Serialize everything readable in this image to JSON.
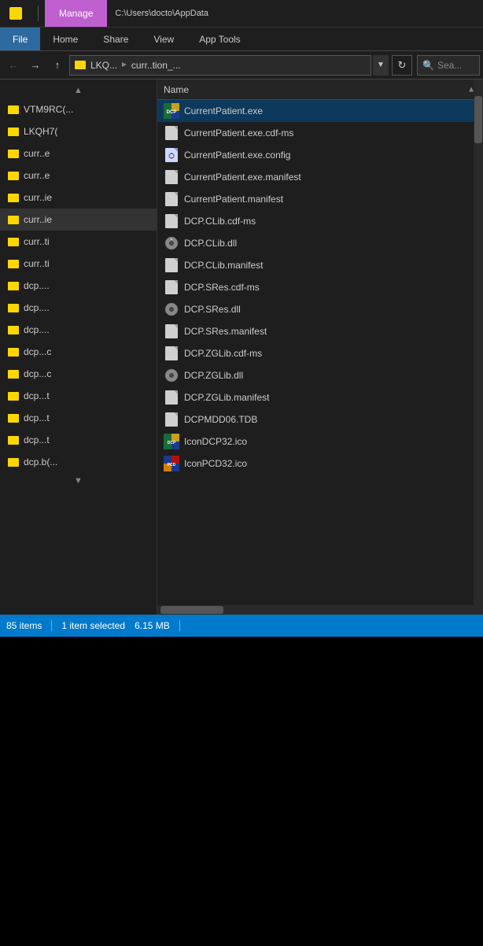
{
  "titlebar": {
    "manage_label": "Manage",
    "path": "C:\\Users\\docto\\AppData"
  },
  "ribbon": {
    "tabs": [
      "File",
      "Home",
      "Share",
      "View",
      "App Tools"
    ]
  },
  "addressbar": {
    "breadcrumb_folder": "LKQH7(...)",
    "breadcrumb_part1": "LKQ...",
    "breadcrumb_part2": "curr..tion_...",
    "search_placeholder": "Sea..."
  },
  "sidebar": {
    "items": [
      {
        "label": "VTM9RC(..."
      },
      {
        "label": "LKQH7("
      },
      {
        "label": "curr..e"
      },
      {
        "label": "curr..e"
      },
      {
        "label": "curr..ie"
      },
      {
        "label": "curr..ie"
      },
      {
        "label": "curr..ti"
      },
      {
        "label": "curr..ti"
      },
      {
        "label": "dcp...."
      },
      {
        "label": "dcp...."
      },
      {
        "label": "dcp...."
      },
      {
        "label": "dcp...c"
      },
      {
        "label": "dcp...c"
      },
      {
        "label": "dcp...t"
      },
      {
        "label": "dcp...t"
      },
      {
        "label": "dcp...t"
      },
      {
        "label": "dcp.b(..."
      }
    ]
  },
  "filelist": {
    "column_name": "Name",
    "items": [
      {
        "name": "CurrentPatient.exe",
        "icon_type": "dcp",
        "selected": true
      },
      {
        "name": "CurrentPatient.exe.cdf-ms",
        "icon_type": "generic",
        "selected": false
      },
      {
        "name": "CurrentPatient.exe.config",
        "icon_type": "config",
        "selected": false
      },
      {
        "name": "CurrentPatient.exe.manifest",
        "icon_type": "generic",
        "selected": false
      },
      {
        "name": "CurrentPatient.manifest",
        "icon_type": "generic",
        "selected": false
      },
      {
        "name": "DCP.CLib.cdf-ms",
        "icon_type": "generic",
        "selected": false
      },
      {
        "name": "DCP.CLib.dll",
        "icon_type": "dll",
        "selected": false
      },
      {
        "name": "DCP.CLib.manifest",
        "icon_type": "generic",
        "selected": false
      },
      {
        "name": "DCP.SRes.cdf-ms",
        "icon_type": "generic",
        "selected": false
      },
      {
        "name": "DCP.SRes.dll",
        "icon_type": "dll",
        "selected": false
      },
      {
        "name": "DCP.SRes.manifest",
        "icon_type": "generic",
        "selected": false
      },
      {
        "name": "DCP.ZGLib.cdf-ms",
        "icon_type": "generic",
        "selected": false
      },
      {
        "name": "DCP.ZGLib.dll",
        "icon_type": "dll",
        "selected": false
      },
      {
        "name": "DCP.ZGLib.manifest",
        "icon_type": "generic",
        "selected": false
      },
      {
        "name": "DCPMDD06.TDB",
        "icon_type": "generic",
        "selected": false
      },
      {
        "name": "IconDCP32.ico",
        "icon_type": "dcp",
        "selected": false
      },
      {
        "name": "IconPCD32.ico",
        "icon_type": "pcd",
        "selected": false
      }
    ]
  },
  "statusbar": {
    "item_count": "85 items",
    "selected_info": "1 item selected",
    "file_size": "6.15 MB"
  }
}
